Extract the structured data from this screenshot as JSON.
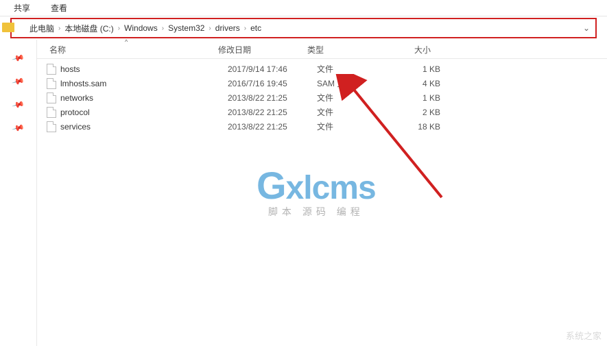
{
  "toolbar": {
    "share": "共享",
    "view": "查看"
  },
  "breadcrumb": [
    "此电脑",
    "本地磁盘 (C:)",
    "Windows",
    "System32",
    "drivers",
    "etc"
  ],
  "columns": {
    "name": "名称",
    "date": "修改日期",
    "type": "类型",
    "size": "大小"
  },
  "files": [
    {
      "name": "hosts",
      "date": "2017/9/14 17:46",
      "type": "文件",
      "size": "1 KB"
    },
    {
      "name": "lmhosts.sam",
      "date": "2016/7/16 19:45",
      "type": "SAM 文件",
      "size": "4 KB"
    },
    {
      "name": "networks",
      "date": "2013/8/22 21:25",
      "type": "文件",
      "size": "1 KB"
    },
    {
      "name": "protocol",
      "date": "2013/8/22 21:25",
      "type": "文件",
      "size": "2 KB"
    },
    {
      "name": "services",
      "date": "2013/8/22 21:25",
      "type": "文件",
      "size": "18 KB"
    }
  ],
  "watermark": {
    "logo": "Gxlcms",
    "sub": "脚本 源码 编程"
  },
  "footer": "系统之家"
}
